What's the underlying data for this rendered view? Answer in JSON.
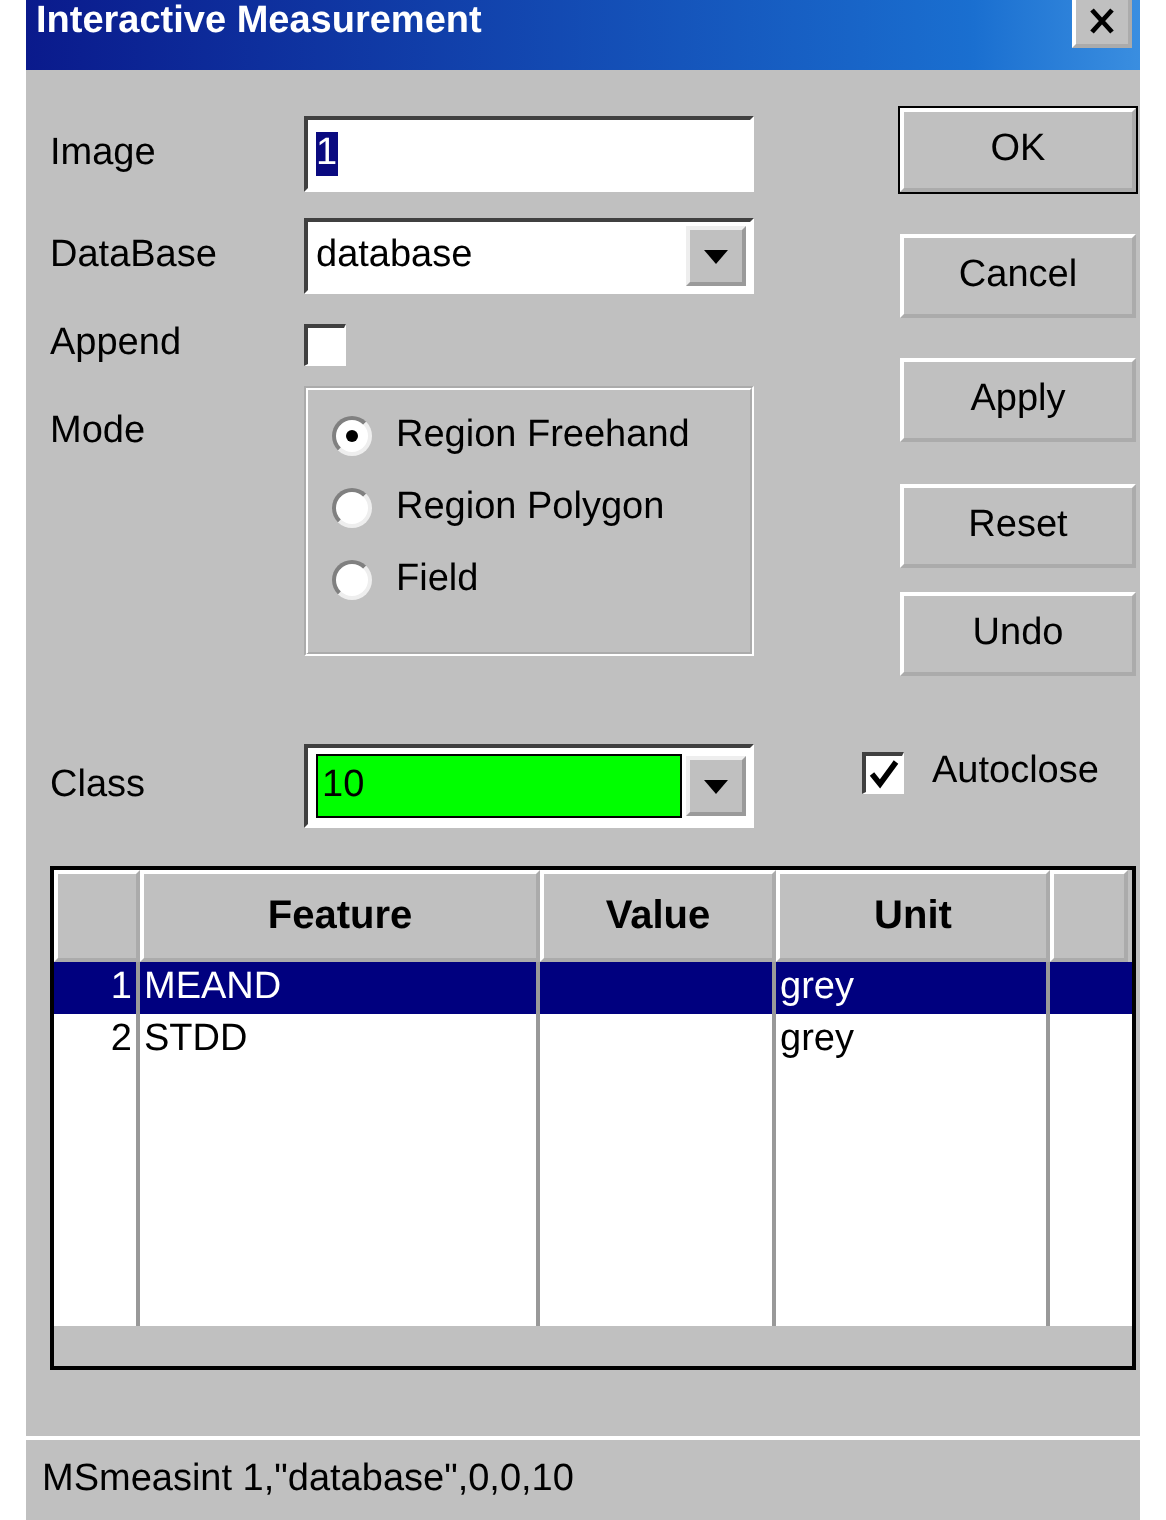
{
  "window": {
    "title": "Interactive Measurement"
  },
  "fields": {
    "image_label": "Image",
    "image_value": "1",
    "database_label": "DataBase",
    "database_value": "database",
    "append_label": "Append",
    "append_checked": false,
    "mode_label": "Mode",
    "class_label": "Class",
    "class_value": "10"
  },
  "mode_options": [
    {
      "label": "Region Freehand",
      "selected": true
    },
    {
      "label": "Region Polygon",
      "selected": false
    },
    {
      "label": "Field",
      "selected": false
    }
  ],
  "buttons": [
    "OK",
    "Cancel",
    "Apply",
    "Reset",
    "Undo"
  ],
  "autoclose": {
    "label": "Autoclose",
    "checked": true
  },
  "table": {
    "columns": [
      "Feature",
      "Value",
      "Unit"
    ],
    "rows": [
      {
        "number": "1",
        "feature": "MEAND",
        "unit": "grey",
        "selected": true
      },
      {
        "number": "2",
        "feature": "STDD",
        "unit": "grey",
        "selected": false
      }
    ]
  },
  "status_bar": "MSmeasint 1,\"database\",0,0,10"
}
